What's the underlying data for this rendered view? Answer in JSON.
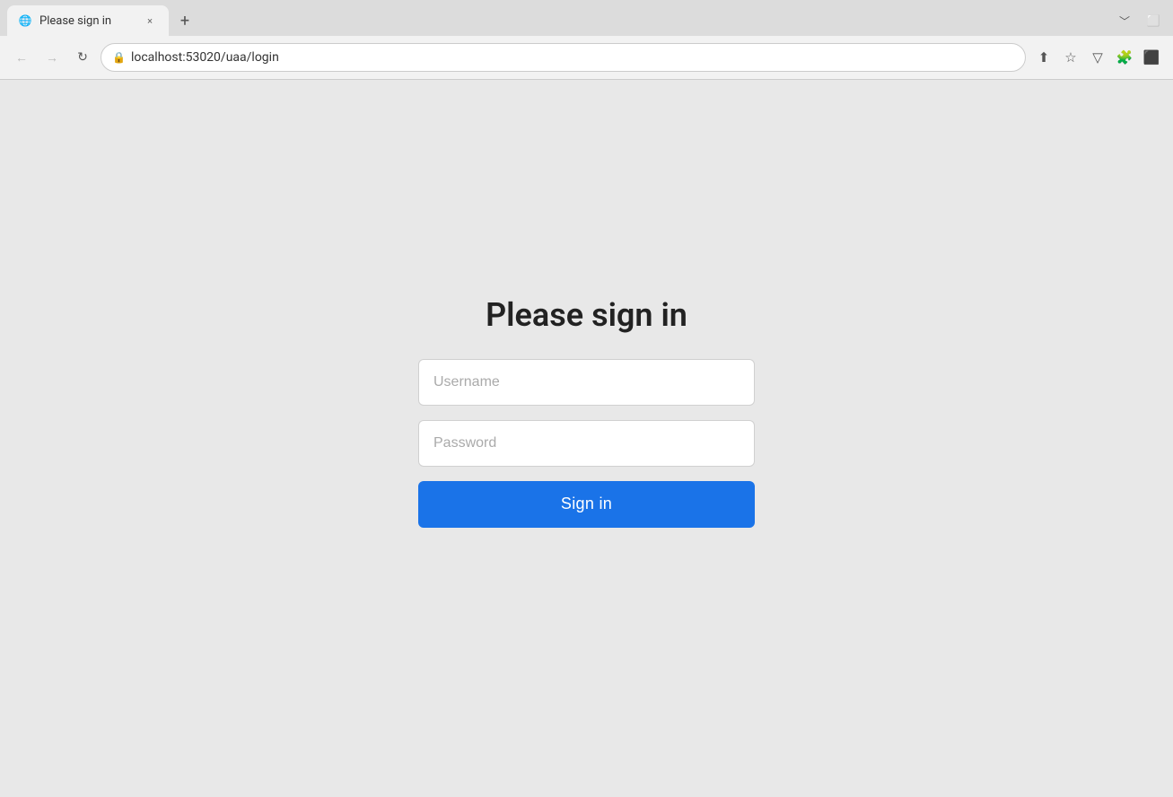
{
  "browser": {
    "tab": {
      "title": "Please sign in",
      "favicon": "🌐",
      "close_label": "×"
    },
    "new_tab_label": "+",
    "window_controls": {
      "minimize": "﹀",
      "maximize": "⬜"
    },
    "nav": {
      "back_label": "←",
      "forward_label": "→",
      "reload_label": "↻"
    },
    "address": {
      "lock_icon": "🔒",
      "url": "localhost:53020/uaa/login"
    },
    "toolbar": {
      "share_icon": "⬆",
      "bookmark_icon": "☆",
      "dropdown_icon": "▽",
      "extensions_icon": "🧩",
      "sidebar_icon": "⬛"
    }
  },
  "page": {
    "heading": "Please sign in",
    "username_placeholder": "Username",
    "password_placeholder": "Password",
    "sign_in_button": "Sign in"
  }
}
